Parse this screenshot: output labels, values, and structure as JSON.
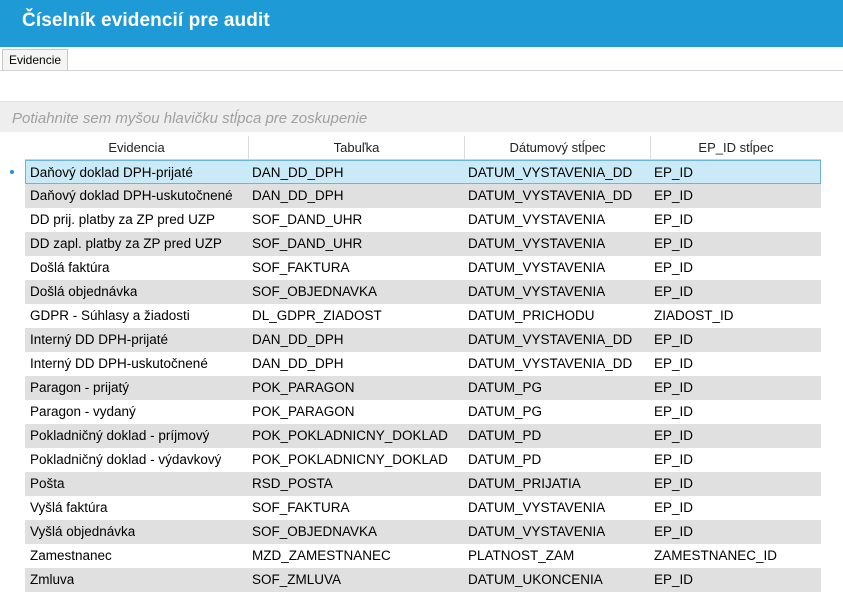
{
  "window": {
    "title": "Číselník evidencií pre audit"
  },
  "tabs": [
    {
      "label": "Evidencie"
    }
  ],
  "group_panel": {
    "hint": "Potiahnite sem myšou hlavičku stĺpca pre zoskupenie"
  },
  "grid": {
    "columns": [
      "Evidencia",
      "Tabuľka",
      "Dátumový stĺpec",
      "EP_ID stĺpec"
    ],
    "selected_row_index": 0,
    "rows": [
      [
        "Daňový doklad DPH-prijaté",
        "DAN_DD_DPH",
        "DATUM_VYSTAVENIA_DD",
        "EP_ID"
      ],
      [
        "Daňový doklad DPH-uskutočnené",
        "DAN_DD_DPH",
        "DATUM_VYSTAVENIA_DD",
        "EP_ID"
      ],
      [
        "DD prij. platby za ZP pred UZP",
        "SOF_DAND_UHR",
        "DATUM_VYSTAVENIA",
        "EP_ID"
      ],
      [
        "DD zapl. platby za ZP pred UZP",
        "SOF_DAND_UHR",
        "DATUM_VYSTAVENIA",
        "EP_ID"
      ],
      [
        "Došlá faktúra",
        "SOF_FAKTURA",
        "DATUM_VYSTAVENIA",
        "EP_ID"
      ],
      [
        "Došlá objednávka",
        "SOF_OBJEDNAVKA",
        "DATUM_VYSTAVENIA",
        "EP_ID"
      ],
      [
        "GDPR - Súhlasy a žiadosti",
        "DL_GDPR_ZIADOST",
        "DATUM_PRICHODU",
        "ZIADOST_ID"
      ],
      [
        "Interný DD DPH-prijaté",
        "DAN_DD_DPH",
        "DATUM_VYSTAVENIA_DD",
        "EP_ID"
      ],
      [
        "Interný DD DPH-uskutočnené",
        "DAN_DD_DPH",
        "DATUM_VYSTAVENIA_DD",
        "EP_ID"
      ],
      [
        "Paragon - prijatý",
        "POK_PARAGON",
        "DATUM_PG",
        "EP_ID"
      ],
      [
        "Paragon - vydaný",
        "POK_PARAGON",
        "DATUM_PG",
        "EP_ID"
      ],
      [
        "Pokladničný doklad - príjmový",
        "POK_POKLADNICNY_DOKLAD",
        "DATUM_PD",
        "EP_ID"
      ],
      [
        "Pokladničný doklad - výdavkový",
        "POK_POKLADNICNY_DOKLAD",
        "DATUM_PD",
        "EP_ID"
      ],
      [
        "Pošta",
        "RSD_POSTA",
        "DATUM_PRIJATIA",
        "EP_ID"
      ],
      [
        "Vyšlá faktúra",
        "SOF_FAKTURA",
        "DATUM_VYSTAVENIA",
        "EP_ID"
      ],
      [
        "Vyšlá objednávka",
        "SOF_OBJEDNAVKA",
        "DATUM_VYSTAVENIA",
        "EP_ID"
      ],
      [
        "Zamestnanec",
        "MZD_ZAMESTNANEC",
        "PLATNOST_ZAM",
        "ZAMESTNANEC_ID"
      ],
      [
        "Zmluva",
        "SOF_ZMLUVA",
        "DATUM_UKONCENIA",
        "EP_ID"
      ]
    ]
  },
  "colors": {
    "titlebar": "#1e9ad7",
    "selected_row": "#cbeaf7",
    "alt_row": "#e0e0e0"
  }
}
